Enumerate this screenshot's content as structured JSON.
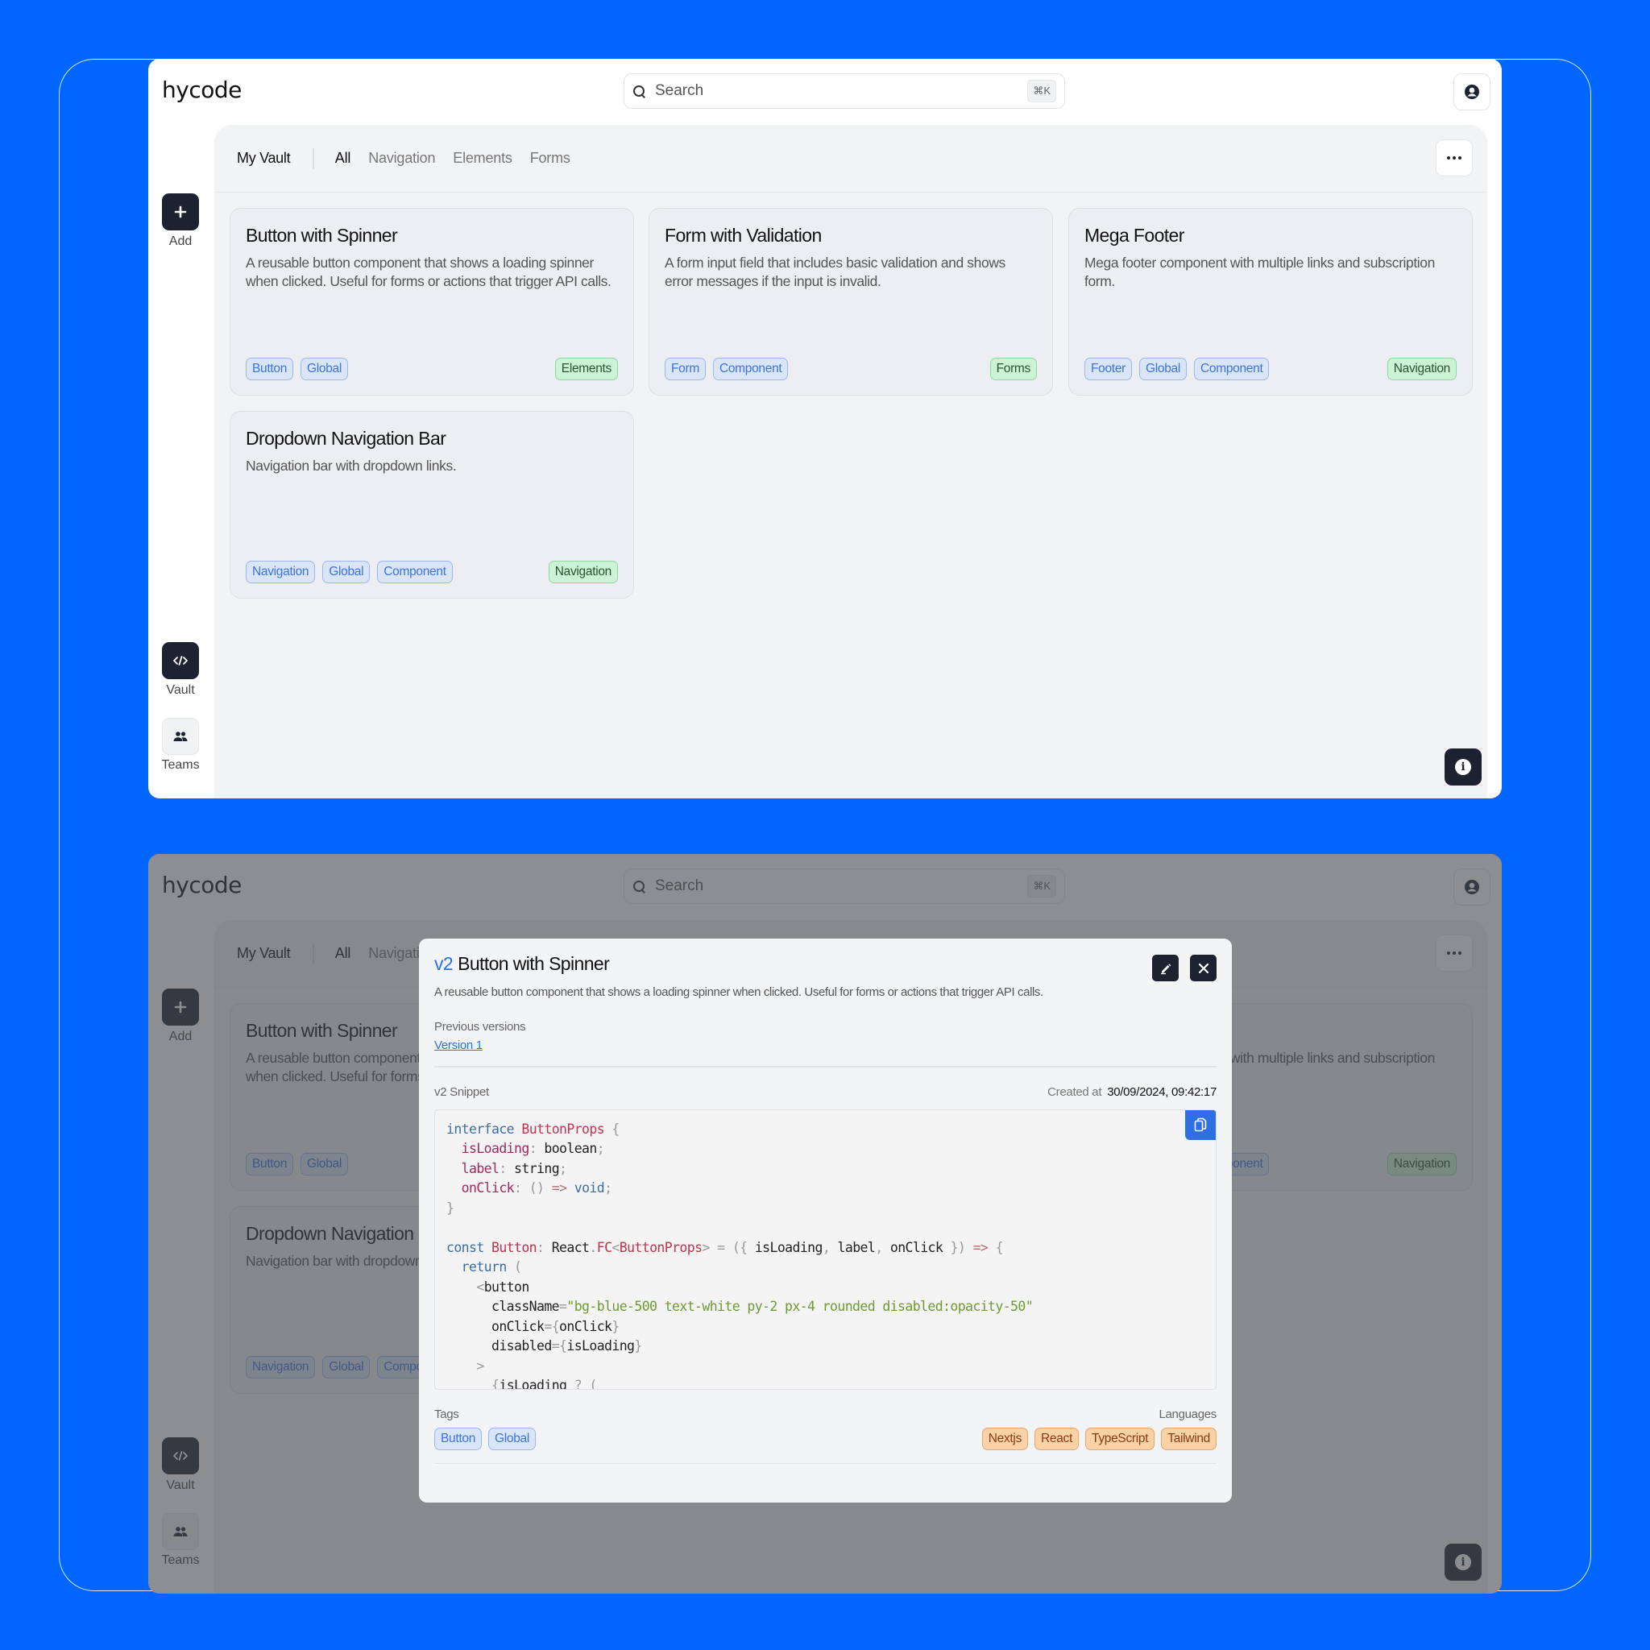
{
  "app": {
    "logo": "hycode",
    "search_placeholder": "Search",
    "search_shortcut": "⌘K"
  },
  "sidebar": {
    "add_label": "Add",
    "vault_label": "Vault",
    "teams_label": "Teams"
  },
  "tabs": {
    "vault_title": "My Vault",
    "items": [
      "All",
      "Navigation",
      "Elements",
      "Forms"
    ],
    "active": "All"
  },
  "cards": [
    {
      "title": "Button with Spinner",
      "description": "A reusable button component that shows a loading spinner when clicked. Useful for forms or actions that trigger API calls.",
      "tags": [
        "Button",
        "Global"
      ],
      "category": "Elements"
    },
    {
      "title": "Form with Validation",
      "description": "A form input field that includes basic validation and shows error messages if the input is invalid.",
      "tags": [
        "Form",
        "Component"
      ],
      "category": "Forms"
    },
    {
      "title": "Mega Footer",
      "description": "Mega footer component with multiple links and subscription form.",
      "tags": [
        "Footer",
        "Global",
        "Component"
      ],
      "category": "Navigation"
    },
    {
      "title": "Dropdown Navigation Bar",
      "description": "Navigation bar with dropdown links.",
      "tags": [
        "Navigation",
        "Global",
        "Component"
      ],
      "category": "Navigation"
    }
  ],
  "modal": {
    "version": "v2",
    "title": "Button with Spinner",
    "description": "A reusable button component that shows a loading spinner when clicked. Useful for forms or actions that trigger API calls.",
    "previous_versions_label": "Previous versions",
    "previous_versions": [
      "Version 1"
    ],
    "snippet_label": "v2 Snippet",
    "created_label": "Created at",
    "created_value": "30/09/2024, 09:42:17",
    "code_lines": [
      "interface ButtonProps {",
      "  isLoading: boolean;",
      "  label: string;",
      "  onClick: () => void;",
      "}",
      "",
      "const Button: React.FC<ButtonProps> = ({ isLoading, label, onClick }) => {",
      "  return (",
      "    <button",
      "      className=\"bg-blue-500 text-white py-2 px-4 rounded disabled:opacity-50\"",
      "      onClick={onClick}",
      "      disabled={isLoading}",
      "    >",
      "      {isLoading ? ("
    ],
    "tags_label": "Tags",
    "tags": [
      "Button",
      "Global"
    ],
    "languages_label": "Languages",
    "languages": [
      "Nextjs",
      "React",
      "TypeScript",
      "Tailwind"
    ]
  },
  "colors": {
    "background": "#0066ff",
    "accent": "#2f6fe4",
    "dark_button": "#1c2230"
  }
}
